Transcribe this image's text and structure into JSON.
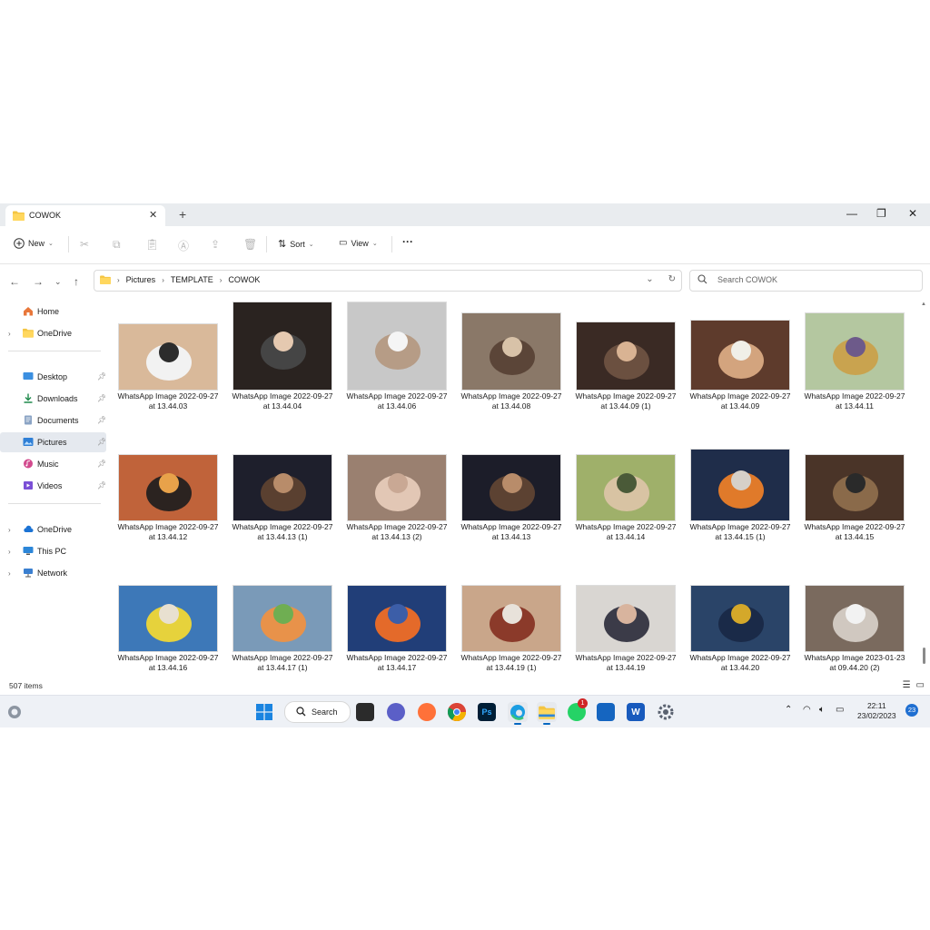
{
  "window": {
    "tab_title": "COWOK",
    "new_tab": "+",
    "controls": {
      "minimize": "—",
      "maximize": "❐",
      "close": "✕"
    }
  },
  "toolbar": {
    "new_label": "New",
    "sort_label": "Sort",
    "view_label": "View",
    "more_label": "···"
  },
  "address": {
    "crumbs": [
      "Pictures",
      "TEMPLATE",
      "COWOK"
    ],
    "search_placeholder": "Search COWOK"
  },
  "sidebar": {
    "items": [
      {
        "label": "Home"
      },
      {
        "label": "OneDrive"
      },
      {
        "label": "Desktop"
      },
      {
        "label": "Downloads"
      },
      {
        "label": "Documents"
      },
      {
        "label": "Pictures"
      },
      {
        "label": "Music"
      },
      {
        "label": "Videos"
      },
      {
        "label": "OneDrive"
      },
      {
        "label": "This PC"
      },
      {
        "label": "Network"
      }
    ]
  },
  "files": [
    {
      "l1": "WhatsApp Image 2022-09-27",
      "l2": "at 13.44.03"
    },
    {
      "l1": "WhatsApp Image 2022-09-27",
      "l2": "at 13.44.04"
    },
    {
      "l1": "WhatsApp Image 2022-09-27",
      "l2": "at 13.44.06"
    },
    {
      "l1": "WhatsApp Image 2022-09-27",
      "l2": "at 13.44.08"
    },
    {
      "l1": "WhatsApp Image 2022-09-27",
      "l2": "at 13.44.09 (1)"
    },
    {
      "l1": "WhatsApp Image 2022-09-27",
      "l2": "at 13.44.09"
    },
    {
      "l1": "WhatsApp Image 2022-09-27",
      "l2": "at 13.44.11"
    },
    {
      "l1": "WhatsApp Image 2022-09-27",
      "l2": "at 13.44.12"
    },
    {
      "l1": "WhatsApp Image 2022-09-27",
      "l2": "at 13.44.13 (1)"
    },
    {
      "l1": "WhatsApp Image 2022-09-27",
      "l2": "at 13.44.13 (2)"
    },
    {
      "l1": "WhatsApp Image 2022-09-27",
      "l2": "at 13.44.13"
    },
    {
      "l1": "WhatsApp Image 2022-09-27",
      "l2": "at 13.44.14"
    },
    {
      "l1": "WhatsApp Image 2022-09-27",
      "l2": "at 13.44.15 (1)"
    },
    {
      "l1": "WhatsApp Image 2022-09-27",
      "l2": "at 13.44.15"
    },
    {
      "l1": "WhatsApp Image 2022-09-27",
      "l2": "at 13.44.16"
    },
    {
      "l1": "WhatsApp Image 2022-09-27",
      "l2": "at 13.44.17 (1)"
    },
    {
      "l1": "WhatsApp Image 2022-09-27",
      "l2": "at 13.44.17"
    },
    {
      "l1": "WhatsApp Image 2022-09-27",
      "l2": "at 13.44.19 (1)"
    },
    {
      "l1": "WhatsApp Image 2022-09-27",
      "l2": "at 13.44.19"
    },
    {
      "l1": "WhatsApp Image 2022-09-27",
      "l2": "at 13.44.20"
    },
    {
      "l1": "WhatsApp Image 2023-01-23",
      "l2": "at 09.44.20 (2)"
    }
  ],
  "status": {
    "item_count": "507 items"
  },
  "taskbar": {
    "search_label": "Search",
    "time": "22:11",
    "date": "23/02/2023",
    "notification_count": "23",
    "whatsapp_badge": "1"
  }
}
